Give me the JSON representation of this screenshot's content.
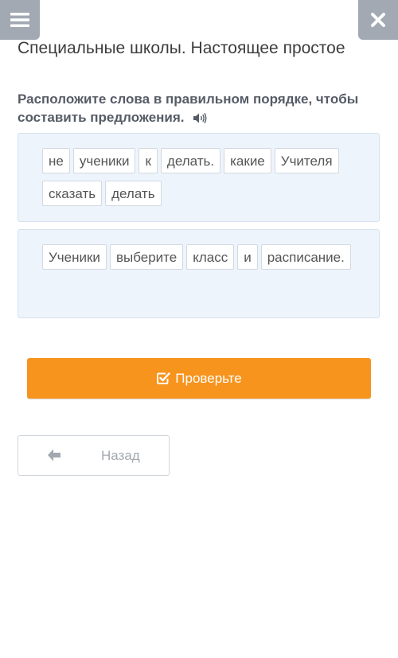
{
  "header": {
    "menu_icon": "hamburger-menu-icon",
    "close_icon": "close-icon",
    "title": "Специальные школы. Настоящее простое"
  },
  "task": {
    "instruction": "Расположите слова в правильном порядке, чтобы составить предложения.",
    "audio_icon": "speaker-icon"
  },
  "sentences": [
    {
      "words": [
        "не",
        "ученики",
        "к",
        "делать.",
        "какие",
        "Учителя",
        "сказать",
        "делать"
      ]
    },
    {
      "words": [
        "Ученики",
        "выберите",
        "класс",
        "и",
        "расписание."
      ]
    }
  ],
  "buttons": {
    "check_label": "Проверьте",
    "back_label": "Назад"
  },
  "colors": {
    "accent": "#f7941d",
    "top_button": "#a2a9b3",
    "card_bg": "#eef4fb"
  }
}
